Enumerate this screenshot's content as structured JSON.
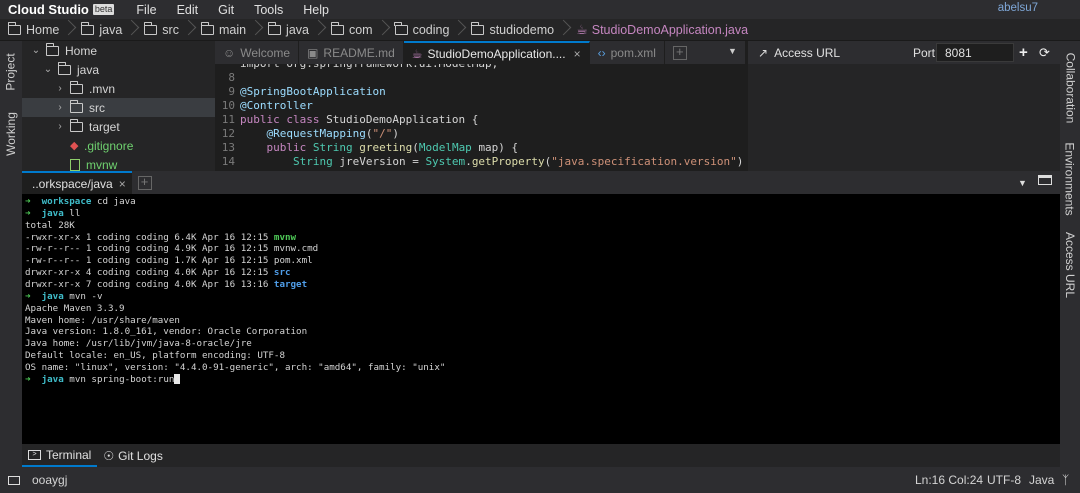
{
  "app": {
    "name": "Cloud Studio",
    "badge": "beta",
    "user": "abelsu7"
  },
  "menu": [
    "File",
    "Edit",
    "Git",
    "Tools",
    "Help"
  ],
  "breadcrumb": [
    "Home",
    "java",
    "src",
    "main",
    "java",
    "com",
    "coding",
    "studiodemo",
    "StudioDemoApplication.java"
  ],
  "left_tabs": [
    "Project",
    "Working"
  ],
  "tree": [
    {
      "label": "Home",
      "caret": "⌄",
      "depth": 0,
      "type": "folder"
    },
    {
      "label": "java",
      "caret": "⌄",
      "depth": 1,
      "type": "folder"
    },
    {
      "label": ".mvn",
      "caret": "›",
      "depth": 2,
      "type": "folder"
    },
    {
      "label": "src",
      "caret": "›",
      "depth": 2,
      "type": "folder",
      "selected": true
    },
    {
      "label": "target",
      "caret": "›",
      "depth": 2,
      "type": "folder"
    },
    {
      "label": ".gitignore",
      "caret": "",
      "depth": 2,
      "type": "git"
    },
    {
      "label": "mvnw",
      "caret": "",
      "depth": 2,
      "type": "file"
    }
  ],
  "editor": {
    "tabs": [
      {
        "label": "Welcome",
        "icon": "☺"
      },
      {
        "label": "README.md",
        "icon": "▣"
      },
      {
        "label": "StudioDemoApplication....",
        "icon": "☕",
        "active": true,
        "close": "×"
      },
      {
        "label": "pom.xml",
        "icon": "‹›"
      }
    ],
    "lines": [
      {
        "n": "",
        "segs": [
          [
            "pl",
            "import org.springframework.ui.ModelMap;"
          ]
        ]
      },
      {
        "n": "8",
        "segs": []
      },
      {
        "n": "9",
        "segs": [
          [
            "ann",
            "@SpringBootApplication"
          ]
        ]
      },
      {
        "n": "10",
        "segs": [
          [
            "ann",
            "@Controller"
          ]
        ]
      },
      {
        "n": "11",
        "segs": [
          [
            "kw",
            "public class "
          ],
          [
            "pl",
            "StudioDemoApplication {"
          ]
        ]
      },
      {
        "n": "12",
        "segs": [
          [
            "pl",
            "    "
          ],
          [
            "ann",
            "@RequestMapping"
          ],
          [
            "pl",
            "("
          ],
          [
            "str",
            "\"/\""
          ],
          [
            "pl",
            ")"
          ]
        ]
      },
      {
        "n": "13",
        "segs": [
          [
            "pl",
            "    "
          ],
          [
            "kw",
            "public "
          ],
          [
            "cls",
            "String "
          ],
          [
            "fn",
            "greeting"
          ],
          [
            "pl",
            "("
          ],
          [
            "cls",
            "ModelMap "
          ],
          [
            "pl",
            "map) {"
          ]
        ]
      },
      {
        "n": "14",
        "segs": [
          [
            "pl",
            "        "
          ],
          [
            "cls",
            "String "
          ],
          [
            "pl",
            "jreVersion = "
          ],
          [
            "cls",
            "System"
          ],
          [
            "pl",
            "."
          ],
          [
            "fn",
            "getProperty"
          ],
          [
            "pl",
            "("
          ],
          [
            "str",
            "\"java.specification.version\""
          ],
          [
            "pl",
            ");"
          ]
        ]
      }
    ]
  },
  "access_url": {
    "label": "Access URL",
    "port_label": "Port",
    "port_value": "8081"
  },
  "right_tabs": [
    "Collaboration",
    "Environments",
    "Access URL"
  ],
  "terminal": {
    "tab_label": "..orkspace/java",
    "lines": [
      [
        [
          "arrow",
          "➜  "
        ],
        [
          "cwd",
          "workspace "
        ],
        [
          "pl",
          "cd java"
        ]
      ],
      [
        [
          "arrow",
          "➜  "
        ],
        [
          "cwd",
          "java "
        ],
        [
          "pl",
          "ll"
        ]
      ],
      [
        [
          "pl",
          "total 28K"
        ]
      ],
      [
        [
          "pl",
          "-rwxr-xr-x 1 coding coding 6.4K Apr 16 12:15 "
        ],
        [
          "exe",
          "mvnw"
        ]
      ],
      [
        [
          "pl",
          "-rw-r--r-- 1 coding coding 4.9K Apr 16 12:15 mvnw.cmd"
        ]
      ],
      [
        [
          "pl",
          "-rw-r--r-- 1 coding coding 1.7K Apr 16 12:15 pom.xml"
        ]
      ],
      [
        [
          "pl",
          "drwxr-xr-x 4 coding coding 4.0K Apr 16 12:15 "
        ],
        [
          "dir",
          "src"
        ]
      ],
      [
        [
          "pl",
          "drwxr-xr-x 7 coding coding 4.0K Apr 16 13:16 "
        ],
        [
          "dir",
          "target"
        ]
      ],
      [
        [
          "arrow",
          "➜  "
        ],
        [
          "cwd",
          "java "
        ],
        [
          "pl",
          "mvn -v"
        ]
      ],
      [
        [
          "pl",
          "Apache Maven 3.3.9"
        ]
      ],
      [
        [
          "pl",
          "Maven home: /usr/share/maven"
        ]
      ],
      [
        [
          "pl",
          "Java version: 1.8.0_161, vendor: Oracle Corporation"
        ]
      ],
      [
        [
          "pl",
          "Java home: /usr/lib/jvm/java-8-oracle/jre"
        ]
      ],
      [
        [
          "pl",
          "Default locale: en_US, platform encoding: UTF-8"
        ]
      ],
      [
        [
          "pl",
          "OS name: \"linux\", version: \"4.4.0-91-generic\", arch: \"amd64\", family: \"unix\""
        ]
      ],
      [
        [
          "arrow",
          "➜  "
        ],
        [
          "cwd",
          "java "
        ],
        [
          "pl",
          "mvn spring-boot:run"
        ],
        [
          "cursor",
          ""
        ]
      ]
    ]
  },
  "bottom_tabs": [
    "Terminal",
    "Git Logs"
  ],
  "status": {
    "left": "ooaygj",
    "position": "Ln:16 Col:24",
    "encoding": "UTF-8",
    "language": "Java"
  },
  "colors": {
    "accent": "#007acc",
    "prompt_green": "#4ec957",
    "cwd_cyan": "#3fbcc9",
    "dir_blue": "#4f9de8",
    "branch_purple": "#c586c0"
  }
}
